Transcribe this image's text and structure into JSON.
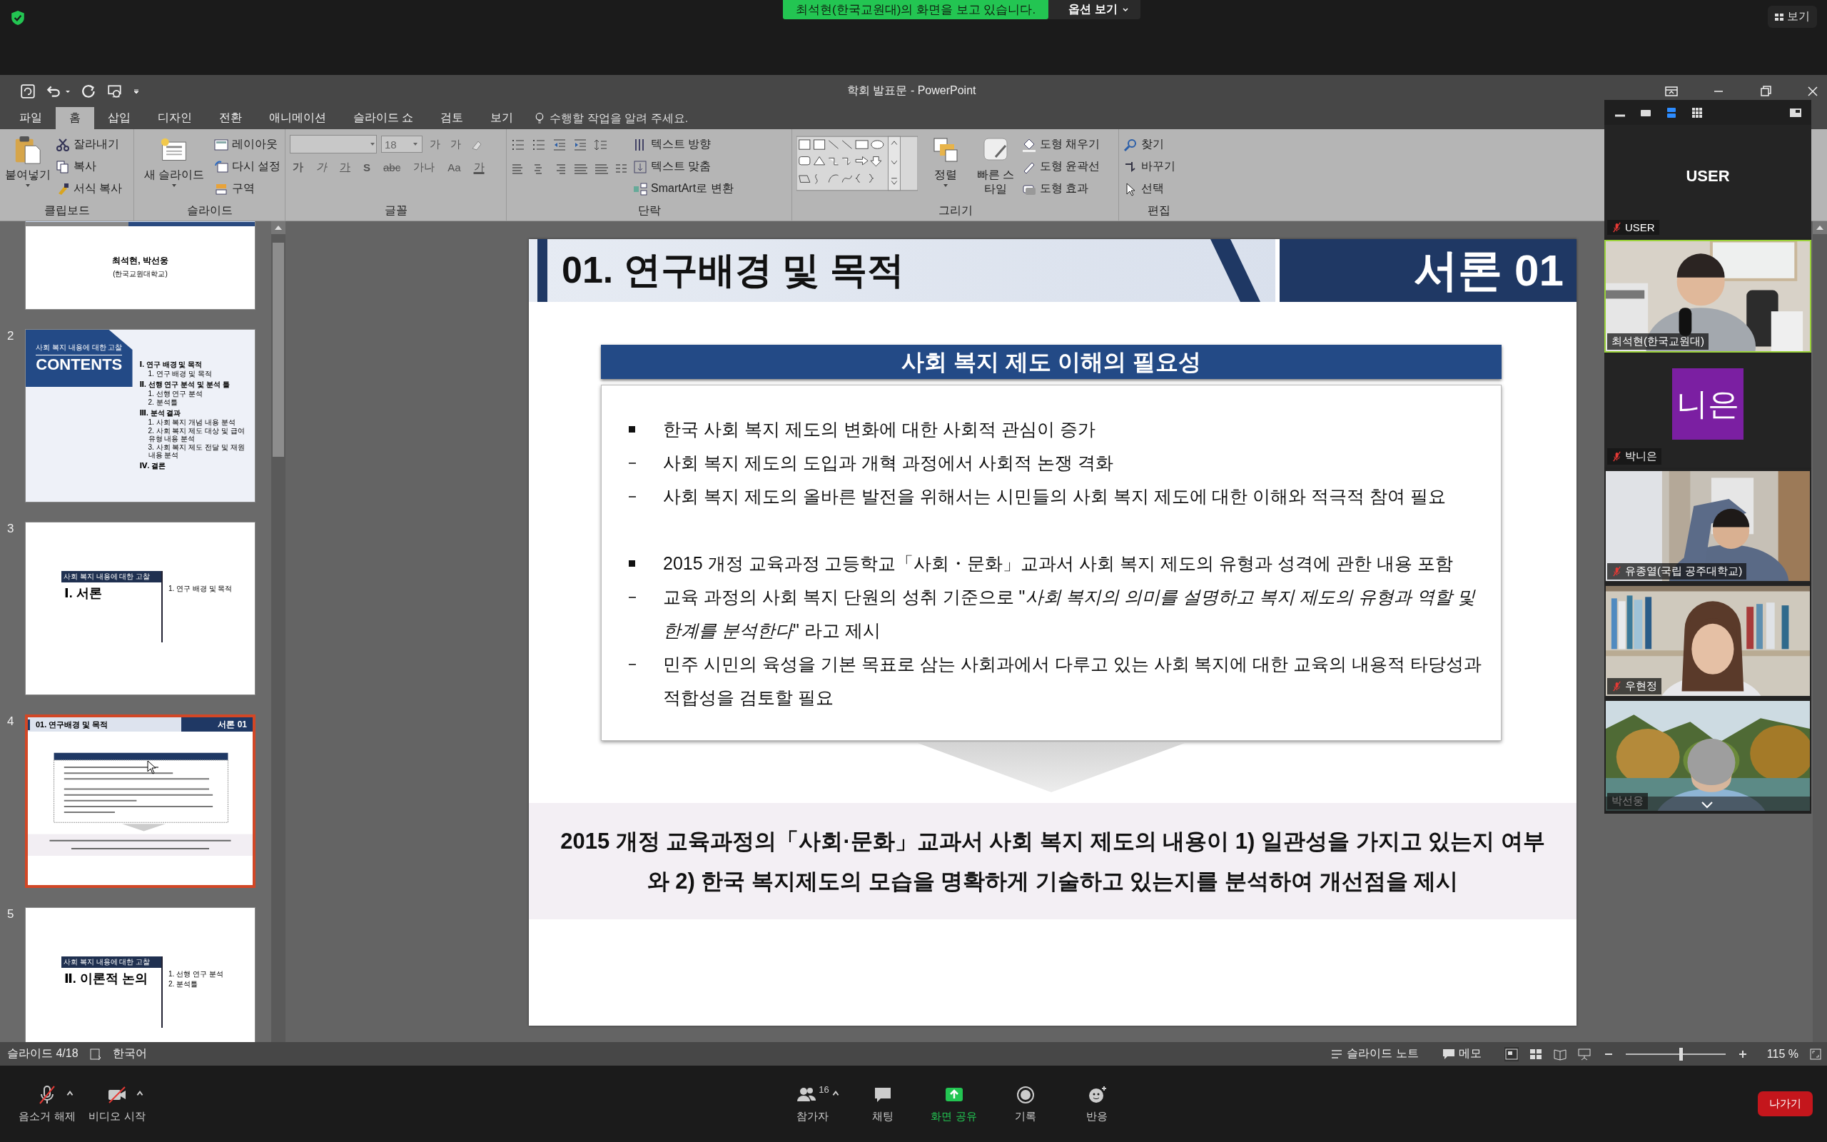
{
  "zoom_top": {
    "banner": "최석현(한국교원대)의 화면을 보고 있습니다.",
    "options": "옵션 보기",
    "view": "보기"
  },
  "window": {
    "title": "학회 발표문 - PowerPoint"
  },
  "ribbon_tabs": [
    {
      "label": "파일",
      "selected": false
    },
    {
      "label": "홈",
      "selected": true
    },
    {
      "label": "삽입",
      "selected": false
    },
    {
      "label": "디자인",
      "selected": false
    },
    {
      "label": "전환",
      "selected": false
    },
    {
      "label": "애니메이션",
      "selected": false
    },
    {
      "label": "슬라이드 쇼",
      "selected": false
    },
    {
      "label": "검토",
      "selected": false
    },
    {
      "label": "보기",
      "selected": false
    }
  ],
  "tell_me": {
    "placeholder": "수행할 작업을 알려 주세요."
  },
  "ribbon": {
    "clipboard": {
      "label": "클립보드",
      "paste": "붙여넣기",
      "commands": [
        "잘라내기",
        "복사",
        "서식 복사"
      ]
    },
    "slides": {
      "label": "슬라이드",
      "new": "새 슬라이드",
      "commands": [
        "레이아웃",
        "다시 설정",
        "구역"
      ]
    },
    "font": {
      "label": "글꼴",
      "size": "18",
      "top_buttons": [
        "가",
        "가"
      ],
      "bottom_buttons": [
        "가",
        "가",
        "가",
        "S",
        "abc",
        "가나",
        "Aa",
        "가"
      ]
    },
    "paragraph": {
      "label": "단락",
      "commands": [
        "텍스트 방향",
        "텍스트 맞춤",
        "SmartArt로 변환"
      ]
    },
    "drawing": {
      "label": "그리기",
      "arrange": "정렬",
      "quick_styles": "빠른 스타일",
      "commands": [
        "도형 채우기",
        "도형 윤곽선",
        "도형 효과"
      ]
    },
    "editing": {
      "label": "편집",
      "commands": [
        "찾기",
        "바꾸기",
        "선택"
      ]
    }
  },
  "thumbnails": [
    {
      "kind": "title",
      "lines": [
        "최석현, 박선웅",
        "(한국교원대학교)"
      ],
      "selected": false
    },
    {
      "number": "2",
      "kind": "contents",
      "label": "사회 복지 내용에 대한 고찰",
      "heading": "CONTENTS",
      "items": [
        {
          "text": "Ⅰ. 연구 배경 및 목적",
          "children": [
            {
              "text": "1. 연구 배경 및 목적"
            }
          ]
        },
        {
          "text": "Ⅱ. 선행 연구 분석 및 분석 틀",
          "children": [
            {
              "text": "1. 선행 연구 분석"
            },
            {
              "text": "2. 분석틀"
            }
          ]
        },
        {
          "text": "Ⅲ. 분석 결과",
          "children": [
            {
              "text": "1. 사회 복지 개념 내용 분석"
            },
            {
              "text": "2. 사회 복지 제도 대상 및 급여 유형 내용 분석"
            },
            {
              "text": "3. 사회 복지 제도 전달 및 재원 내용 분석"
            }
          ]
        },
        {
          "text": "Ⅳ. 결론"
        }
      ],
      "selected": false
    },
    {
      "number": "3",
      "kind": "section",
      "label": "사회 복지 내용에 대한 고찰",
      "heading": "Ⅰ. 서론",
      "items": [
        "1. 연구 배경 및 목적"
      ],
      "selected": false
    },
    {
      "number": "4",
      "kind": "current",
      "title": "01. 연구배경 및 목적",
      "tag": "서론 01",
      "selected": true
    },
    {
      "number": "5",
      "kind": "section",
      "label": "사회 복지 내용에 대한 고찰",
      "heading": "Ⅱ. 이론적 논의",
      "items": [
        "1. 선행 연구 분석",
        "2. 분석틀"
      ],
      "selected": false
    }
  ],
  "slide": {
    "title": "01. 연구배경 및 목적",
    "tag": "서론 01",
    "box_title": "사회 복지 제도 이해의 필요성",
    "groups": [
      [
        {
          "kind": "square",
          "text": "한국 사회 복지 제도의 변화에 대한 사회적 관심이 증가"
        },
        {
          "kind": "dash",
          "text": "사회 복지 제도의 도입과 개혁 과정에서 사회적 논쟁 격화"
        },
        {
          "kind": "dash",
          "text": "사회 복지 제도의 올바른 발전을 위해서는 시민들의 사회 복지 제도에 대한 이해와 적극적 참여 필요"
        }
      ],
      [
        {
          "kind": "square",
          "text": "2015 개정 교육과정 고등학교「사회・문화」교과서 사회 복지 제도의 유형과 성격에 관한 내용 포함"
        },
        {
          "kind": "dash",
          "text": "교육 과정의 사회 복지 단원의 성취 기준으로 \"*사회 복지의 의미를 설명하고 복지 제도의 유형과 역할 및 한계를 분석한다*\" 라고 제시"
        },
        {
          "kind": "dash",
          "text": "민주 시민의 육성을 기본 목표로 삼는 사회과에서 다루고 있는 사회 복지에 대한 교육의 내용적 타당성과 적합성을 검토할 필요"
        }
      ]
    ],
    "conclusion": [
      "2015 개정 교육과정의「사회·문화」교과서 사회 복지 제도의 내용이 1) 일관성을 가지고 있는지 여부",
      "와 2) 한국 복지제도의 모습을 명확하게 기술하고 있는지를 분석하여 개선점을 제시"
    ]
  },
  "participants": [
    {
      "kind": "name",
      "name": "USER",
      "label": "USER",
      "muted": true
    },
    {
      "kind": "video",
      "label": "최석현(한국교원대)",
      "muted": false,
      "speaking": true
    },
    {
      "kind": "avatar",
      "initials": "니은",
      "color": "#7b1fa2",
      "label": "박니은",
      "muted": true
    },
    {
      "kind": "video",
      "label": "유종열(국립 공주대학교)",
      "muted": true,
      "speaking": false
    },
    {
      "kind": "video",
      "label": "우현정",
      "muted": true,
      "speaking": false
    },
    {
      "kind": "video",
      "label": "박선웅",
      "muted": false,
      "speaking": false
    }
  ],
  "status_bar": {
    "slide": "슬라이드 4/18",
    "language": "한국어",
    "notes": "슬라이드 노트",
    "comments": "메모",
    "zoom": "115 %",
    "level": 0.55
  },
  "meeting_controls": [
    {
      "kind": "mic",
      "label": "음소거 해제"
    },
    {
      "kind": "video",
      "label": "비디오 시작"
    },
    {
      "kind": "participants",
      "label": "참가자",
      "count": "16"
    },
    {
      "kind": "chat",
      "label": "채팅"
    },
    {
      "kind": "share",
      "label": "화면 공유"
    },
    {
      "kind": "record",
      "label": "기록"
    },
    {
      "kind": "reactions",
      "label": "반응"
    }
  ],
  "leave": "나가기"
}
